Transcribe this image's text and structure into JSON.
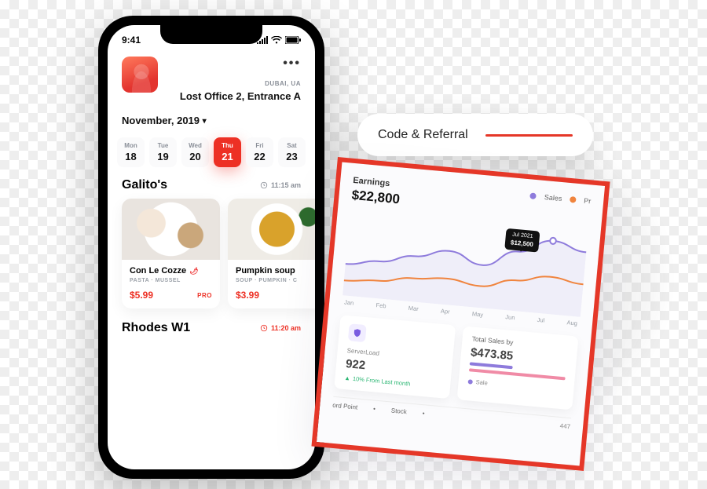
{
  "phone": {
    "status": {
      "time": "9:41"
    },
    "header": {
      "dots": "•••",
      "sub": "DUBAI, UA",
      "address": "Lost Office 2, Entrance A"
    },
    "month_label": "November, 2019",
    "dates": [
      {
        "dw": "Mon",
        "dn": "18"
      },
      {
        "dw": "Tue",
        "dn": "19"
      },
      {
        "dw": "Wed",
        "dn": "20"
      },
      {
        "dw": "Thu",
        "dn": "21",
        "active": true
      },
      {
        "dw": "Fri",
        "dn": "22"
      },
      {
        "dw": "Sat",
        "dn": "23"
      }
    ],
    "sections": [
      {
        "title": "Galito's",
        "time": "11:15 am",
        "cards": [
          {
            "title": "Con Le Cozze",
            "tags": "PASTA · MUSSEL",
            "price": "$5.99",
            "badge": "PRO",
            "spicy": true,
            "img": "cozze"
          },
          {
            "title": "Pumpkin soup",
            "tags": "SOUP · PUMPKIN · C",
            "price": "$3.99",
            "badge": "",
            "spicy": false,
            "img": "pumpkin"
          }
        ]
      },
      {
        "title": "Rhodes W1",
        "time": "11:20 am",
        "cards": []
      }
    ]
  },
  "pill": {
    "label": "Code & Referral"
  },
  "chart_data": {
    "type": "line",
    "title": "Earnings",
    "headline_value": "$22,800",
    "xlabel": "",
    "ylabel": "",
    "categories": [
      "Jan",
      "Feb",
      "Mar",
      "Apr",
      "May",
      "Jun",
      "Jul",
      "Aug"
    ],
    "series": [
      {
        "name": "Sales",
        "color": "#8e7bdc",
        "values": [
          5000,
          6000,
          7500,
          9000,
          7000,
          10000,
          12500,
          11000
        ]
      },
      {
        "name": "Profit",
        "color": "#f0843e",
        "values": [
          2000,
          2500,
          3500,
          4000,
          3200,
          4800,
          6000,
          5200
        ],
        "legend_label": "Pr"
      }
    ],
    "tooltip": {
      "label": "Jul 2021",
      "value": "$12,500",
      "at": "Jul"
    },
    "ylim": [
      0,
      14000
    ]
  },
  "dashboard": {
    "server_load": {
      "label": "ServerLoad",
      "value": "922",
      "change": "10% From Last month",
      "change_arrow": "▲"
    },
    "total_sales": {
      "label": "Total Sales by",
      "value": "$473.85",
      "legend_item": "Sale"
    },
    "footer": {
      "left1": "ord Point",
      "left2": "Stock",
      "right": "447"
    },
    "cut_label": "onth"
  }
}
